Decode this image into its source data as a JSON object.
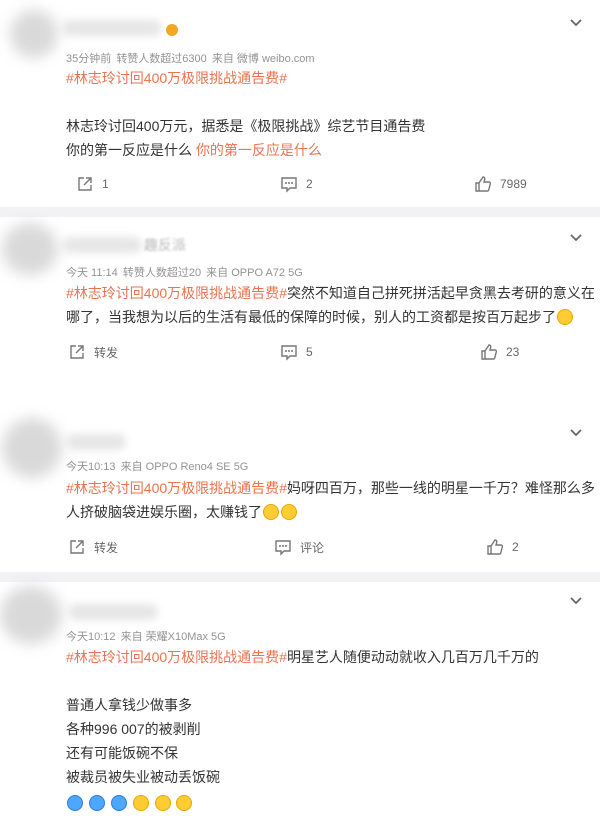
{
  "posts": [
    {
      "name_tail": "",
      "meta": {
        "time": "35分钟前",
        "reposts": "转赞人数超过6300",
        "source": "来自 微博 weibo.com"
      },
      "hashtag": "#林志玲讨回400万极限挑战通告费#",
      "line1": "林志玲讨回400万元，据悉是《极限挑战》综艺节目通告费",
      "line2_plain": "你的第一反应是什么",
      "line2_link": "你的第一反应是什么",
      "actions": {
        "repost": "1",
        "comment": "2",
        "like": "7989"
      }
    },
    {
      "name_tail": "趣反派",
      "meta": {
        "time": "今天 11:14",
        "reposts": "转赞人数超过20",
        "source": "来自 OPPO A72 5G"
      },
      "hashtag": "#林志玲讨回400万极限挑战通告费#",
      "line1_rest": "突然不知道自己拼死拼活起早贪黑去考研的意义在",
      "line2": "哪了，当我想为以后的生活有最低的保障的时候，别人的工资都是按百万起步了",
      "actions": {
        "repost": "转发",
        "comment": "5",
        "like": "23"
      }
    },
    {
      "meta": {
        "time": "今天10:13",
        "source": "来自 OPPO Reno4 SE 5G"
      },
      "hashtag": "#林志玲讨回400万极限挑战通告费#",
      "line1_rest": "妈呀四百万，那些一线的明星一千万？难怪那么多",
      "line2": "人挤破脑袋进娱乐圈，太赚钱了",
      "actions": {
        "repost": "转发",
        "comment": "评论",
        "like": "2"
      }
    },
    {
      "meta": {
        "time": "今天10:12",
        "source": "来自 荣耀X10Max 5G"
      },
      "hashtag": "#林志玲讨回400万极限挑战通告费#",
      "line1_rest": "明星艺人随便动动就收入几百万几千万的",
      "lines": [
        "普通人拿钱少做事多",
        "各种996 007的被剥削",
        "还有可能饭碗不保",
        "被裁员被失业被动丢饭碗"
      ]
    }
  ],
  "colors": {
    "hashtag": "#eb7350",
    "meta": "#939393",
    "divider": "#f2f2f5"
  }
}
